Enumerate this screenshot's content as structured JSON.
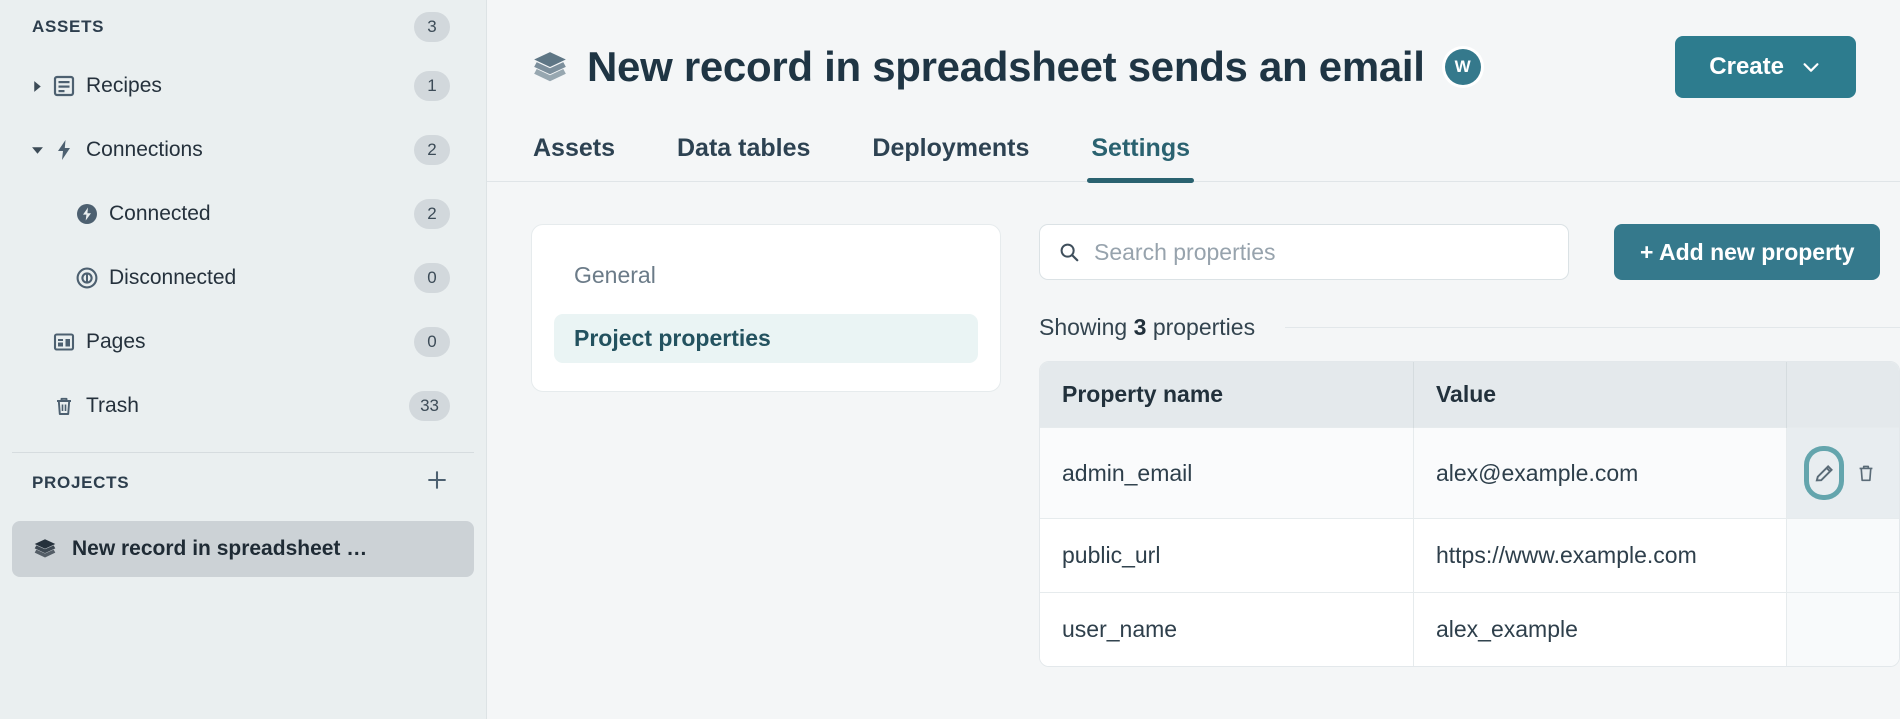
{
  "colors": {
    "accent_teal": "#2d7c8e",
    "accent_button": "#35798c",
    "active_tab": "#2a6270",
    "sidebar_bg": "#eaeff0",
    "main_bg": "#f4f6f7",
    "highlight_ring": "#64a5ad",
    "text_dark": "#22313c"
  },
  "sidebar": {
    "assets": {
      "title": "ASSETS",
      "count": "3"
    },
    "items": [
      {
        "label": "Recipes",
        "count": "1",
        "icon": "recipe-icon",
        "level": 1,
        "twisty": "collapsed"
      },
      {
        "label": "Connections",
        "count": "2",
        "icon": "lightning-icon",
        "level": 1,
        "twisty": "expanded"
      },
      {
        "label": "Connected",
        "count": "2",
        "icon": "connected-icon",
        "level": 2,
        "twisty": "none"
      },
      {
        "label": "Disconnected",
        "count": "0",
        "icon": "disconnected-icon",
        "level": 2,
        "twisty": "none"
      },
      {
        "label": "Pages",
        "count": "0",
        "icon": "pages-icon",
        "level": 1,
        "twisty": "none"
      },
      {
        "label": "Trash",
        "count": "33",
        "icon": "trash-icon",
        "level": 1,
        "twisty": "none"
      }
    ],
    "projects": {
      "title": "PROJECTS",
      "add_label": "+",
      "selected_project": "New record in spreadsheet …"
    }
  },
  "header": {
    "title": "New record in spreadsheet sends an email",
    "avatar_initial": "W",
    "create_label": "Create",
    "create_caret": "chevron-down-icon"
  },
  "tabs": [
    {
      "label": "Assets",
      "active": false
    },
    {
      "label": "Data tables",
      "active": false
    },
    {
      "label": "Deployments",
      "active": false
    },
    {
      "label": "Settings",
      "active": true
    }
  ],
  "settings_nav": [
    {
      "label": "General",
      "active": false
    },
    {
      "label": "Project properties",
      "active": true
    }
  ],
  "properties_panel": {
    "search": {
      "placeholder": "Search properties",
      "value": ""
    },
    "add_new_property_label": "+ Add new property",
    "showing": {
      "prefix": "Showing",
      "count": "3",
      "suffix": "properties"
    },
    "table": {
      "columns": [
        "Property name",
        "Value",
        ""
      ],
      "rows": [
        {
          "name": "admin_email",
          "value": "alex@example.com",
          "hovered": true,
          "edit_highlighted": true,
          "show_actions": true
        },
        {
          "name": "public_url",
          "value": "https://www.example.com",
          "hovered": false,
          "edit_highlighted": false,
          "show_actions": false
        },
        {
          "name": "user_name",
          "value": "alex_example",
          "hovered": false,
          "edit_highlighted": false,
          "show_actions": false
        }
      ]
    }
  }
}
